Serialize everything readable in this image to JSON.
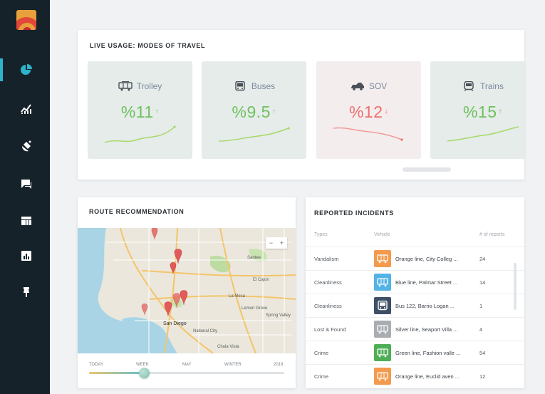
{
  "colors": {
    "sidebar": "#16222a",
    "accent": "#2eb3c8",
    "up_green": "#6fc15f",
    "down_red": "#ef6e6e",
    "orange": "#f39a4c",
    "blue": "#53b3e6",
    "navy": "#3e4f66",
    "gray": "#a9adb2",
    "green": "#4eae56"
  },
  "sidebar": {
    "items": [
      {
        "icon": "pie-chart-icon"
      },
      {
        "icon": "line-chart-icon"
      },
      {
        "icon": "satellite-icon"
      },
      {
        "icon": "chat-icon"
      },
      {
        "icon": "dashboard-icon"
      },
      {
        "icon": "bar-chart-icon"
      },
      {
        "icon": "pin-icon"
      }
    ]
  },
  "live_usage": {
    "title": "LIVE USAGE: MODES OF TRAVEL",
    "modes": [
      {
        "label": "Trolley",
        "value": "%11",
        "trend": "up",
        "arrow": "↑",
        "icon": "trolley-icon",
        "bg": "#e5ece9",
        "color": "#6fc15f"
      },
      {
        "label": "Buses",
        "value": "%9.5",
        "trend": "up",
        "arrow": "↑",
        "icon": "bus-icon",
        "bg": "#e5ece9",
        "color": "#6fc15f"
      },
      {
        "label": "SOV",
        "value": "%12",
        "trend": "down",
        "arrow": "↓",
        "icon": "car-icon",
        "bg": "#f4eded",
        "color": "#ef6e6e"
      },
      {
        "label": "Trains",
        "value": "%15",
        "trend": "up",
        "arrow": "↑",
        "icon": "train-icon",
        "bg": "#e5ece9",
        "color": "#6fc15f"
      }
    ]
  },
  "route": {
    "title": "ROUTE RECOMMENDATION",
    "map_labels": [
      "San Diego",
      "National City",
      "Chula Vista",
      "La Mesa",
      "El Cajon",
      "Santee",
      "Lemon Grove",
      "Spring Valley"
    ],
    "zoom_out": "−",
    "zoom_in": "+",
    "timeline": {
      "labels": [
        "TODAY",
        "WEEK",
        "MAY",
        "WINTER",
        "2018"
      ],
      "position": 0.28
    }
  },
  "incidents": {
    "title": "REPORTED INCIDENTS",
    "columns": [
      "Types",
      "Vehicle",
      "# of reports"
    ],
    "rows": [
      {
        "type": "Vandalism",
        "vehicle": "Orange line, City Colleg ...",
        "reports": "24",
        "icon": "trolley-icon",
        "color": "#f39a4c"
      },
      {
        "type": "Cleanliness",
        "vehicle": "Blue line, Palmar Street ...",
        "reports": "14",
        "icon": "trolley-icon",
        "color": "#53b3e6"
      },
      {
        "type": "Cleanliness",
        "vehicle": "Bus 122, Barrio Logan ...",
        "reports": "1",
        "icon": "bus-icon",
        "color": "#3e4f66"
      },
      {
        "type": "Lost & Found",
        "vehicle": "Silver line, Seaport Villa ...",
        "reports": "4",
        "icon": "trolley-icon",
        "color": "#a9adb2"
      },
      {
        "type": "Crime",
        "vehicle": "Green line, Fashion valle ...",
        "reports": "54",
        "icon": "trolley-icon",
        "color": "#4eae56"
      },
      {
        "type": "Crime",
        "vehicle": "Orange line, Euclid aven ...",
        "reports": "12",
        "icon": "trolley-icon",
        "color": "#f39a4c"
      }
    ]
  }
}
